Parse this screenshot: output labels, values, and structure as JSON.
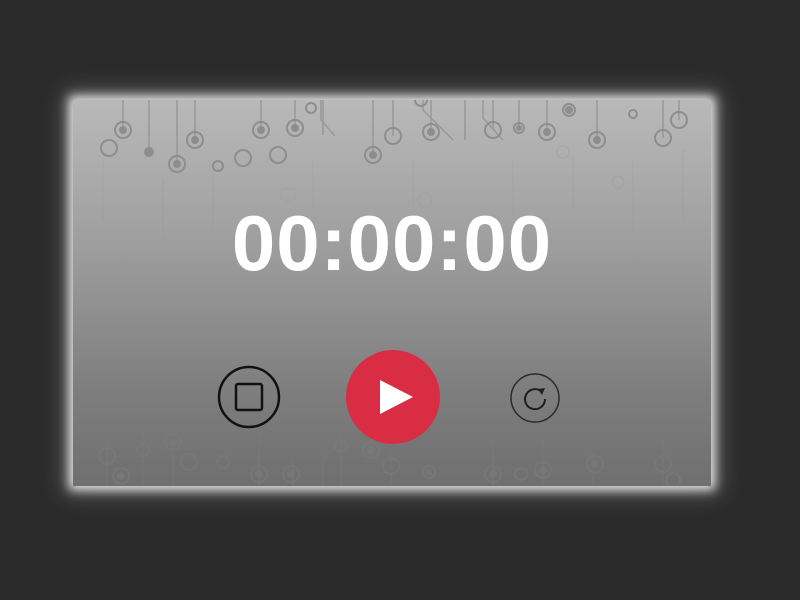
{
  "timer": {
    "display": "00:00:00"
  },
  "controls": {
    "stop_icon": "stop-icon",
    "play_icon": "play-icon",
    "reset_icon": "reset-icon"
  },
  "colors": {
    "play_accent": "#d92d43",
    "timer_text": "#ffffff",
    "background": "#2b2b2b"
  }
}
